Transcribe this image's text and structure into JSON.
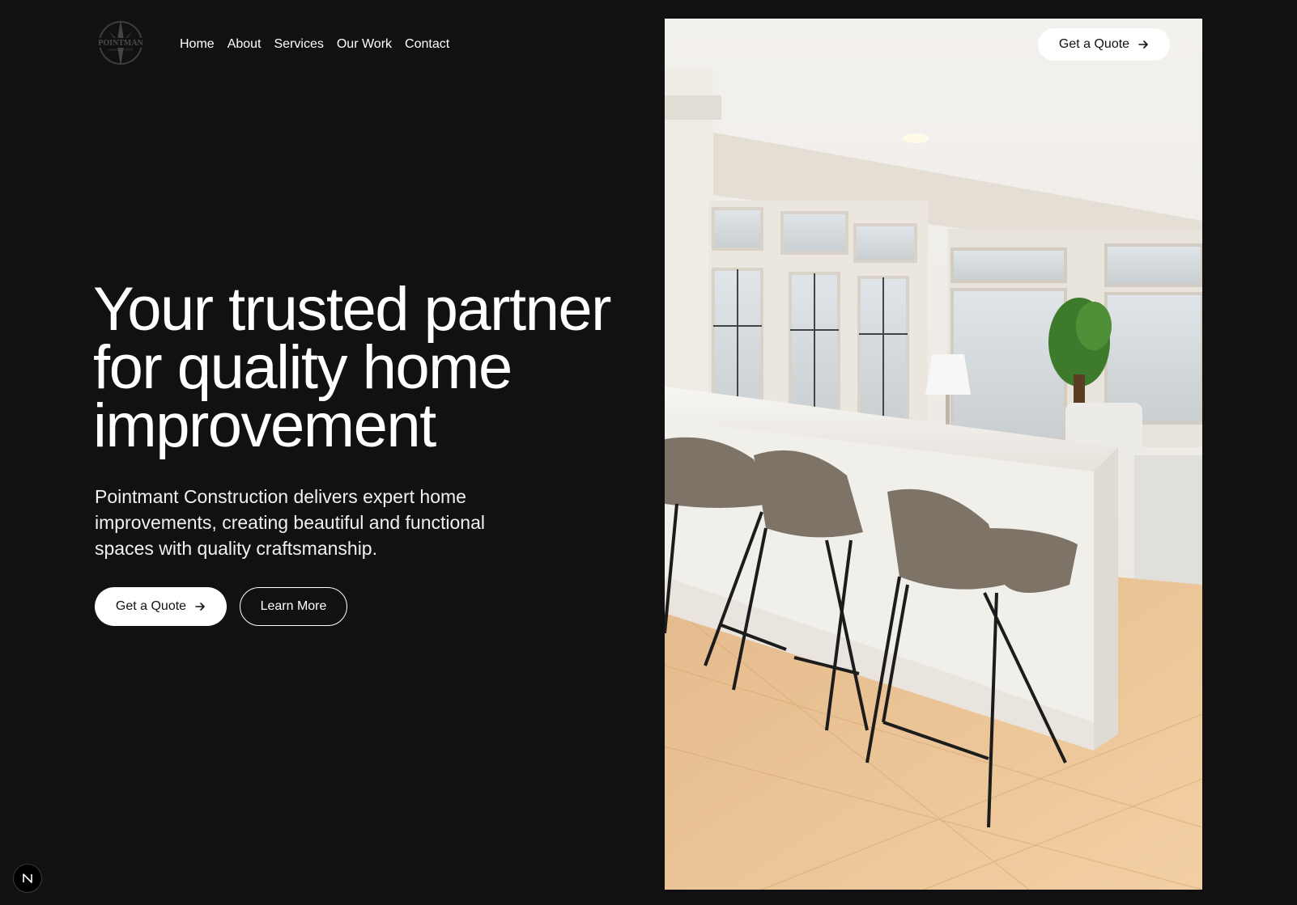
{
  "brand": {
    "logo_text": "POINTMAN",
    "logo_subtext": "CONSTRUCTION",
    "logo_icon": "compass-star-icon"
  },
  "nav": {
    "items": [
      {
        "label": "Home"
      },
      {
        "label": "About"
      },
      {
        "label": "Services"
      },
      {
        "label": "Our Work"
      },
      {
        "label": "Contact"
      }
    ]
  },
  "header": {
    "quote_label": "Get a Quote",
    "quote_icon": "arrow-right-icon"
  },
  "hero": {
    "title": "Your trusted partner for quality home improvement",
    "subtitle": "Pointmant Construction delivers expert home improvements, creating beautiful and functional spaces with quality craftsmanship.",
    "primary_cta": "Get a Quote",
    "secondary_cta": "Learn More",
    "image_icon": "kitchen-photo"
  },
  "dev_badge": {
    "letter": "N",
    "icon": "nextjs-badge-icon"
  },
  "colors": {
    "background": "#111111",
    "text": "#ffffff",
    "button_bg": "#ffffff",
    "button_text": "#111111"
  }
}
